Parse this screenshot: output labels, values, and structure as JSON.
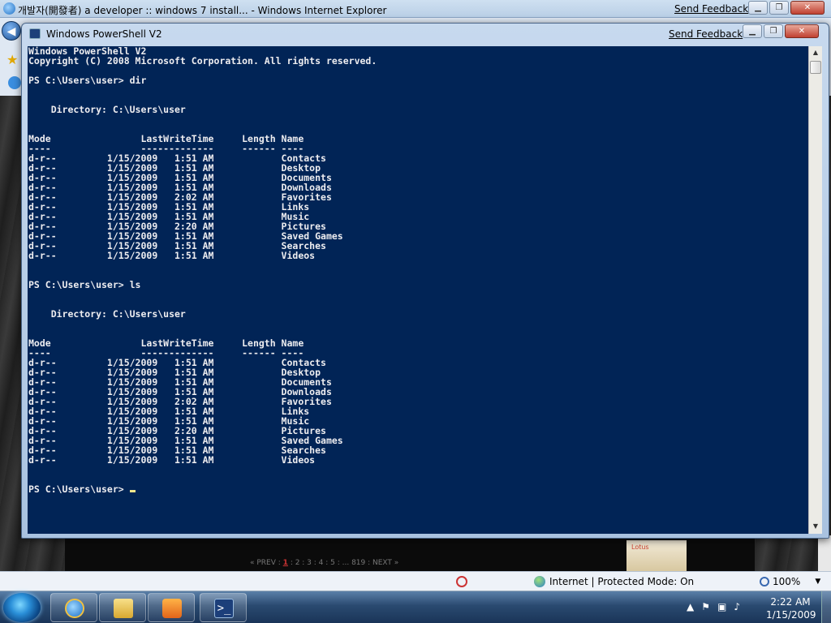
{
  "ie": {
    "title": "개발자(開發者) a developer :: windows 7 install... - Windows Internet Explorer",
    "send_feedback": "Send Feedback",
    "pager": {
      "prev": "« PREV :",
      "current": "1",
      "rest": ": 2 : 3 : 4 : 5 : ... 819 : NEXT »"
    },
    "book_label": "Lotus",
    "status_zone": "Internet | Protected Mode: On",
    "zoom": "100%"
  },
  "powershell": {
    "title": "Windows PowerShell V2",
    "send_feedback": "Send Feedback",
    "console_lines": [
      "Windows PowerShell V2",
      "Copyright (C) 2008 Microsoft Corporation. All rights reserved.",
      "",
      "PS C:\\Users\\user> dir",
      "",
      "",
      "    Directory: C:\\Users\\user",
      "",
      "",
      "Mode                LastWriteTime     Length Name",
      "----                -------------     ------ ----",
      "d-r--         1/15/2009   1:51 AM            Contacts",
      "d-r--         1/15/2009   1:51 AM            Desktop",
      "d-r--         1/15/2009   1:51 AM            Documents",
      "d-r--         1/15/2009   1:51 AM            Downloads",
      "d-r--         1/15/2009   2:02 AM            Favorites",
      "d-r--         1/15/2009   1:51 AM            Links",
      "d-r--         1/15/2009   1:51 AM            Music",
      "d-r--         1/15/2009   2:20 AM            Pictures",
      "d-r--         1/15/2009   1:51 AM            Saved Games",
      "d-r--         1/15/2009   1:51 AM            Searches",
      "d-r--         1/15/2009   1:51 AM            Videos",
      "",
      "",
      "PS C:\\Users\\user> ls",
      "",
      "",
      "    Directory: C:\\Users\\user",
      "",
      "",
      "Mode                LastWriteTime     Length Name",
      "----                -------------     ------ ----",
      "d-r--         1/15/2009   1:51 AM            Contacts",
      "d-r--         1/15/2009   1:51 AM            Desktop",
      "d-r--         1/15/2009   1:51 AM            Documents",
      "d-r--         1/15/2009   1:51 AM            Downloads",
      "d-r--         1/15/2009   2:02 AM            Favorites",
      "d-r--         1/15/2009   1:51 AM            Links",
      "d-r--         1/15/2009   1:51 AM            Music",
      "d-r--         1/15/2009   2:20 AM            Pictures",
      "d-r--         1/15/2009   1:51 AM            Saved Games",
      "d-r--         1/15/2009   1:51 AM            Searches",
      "d-r--         1/15/2009   1:51 AM            Videos",
      "",
      "",
      "PS C:\\Users\\user> "
    ],
    "colors": {
      "background": "#012456",
      "foreground": "#eeedf0",
      "cursor": "#f0e68c"
    }
  },
  "taskbar": {
    "buttons": [
      "internet-explorer",
      "windows-explorer",
      "windows-media-player",
      "windows-powershell"
    ],
    "clock_time": "2:22 AM",
    "clock_date": "1/15/2009"
  }
}
